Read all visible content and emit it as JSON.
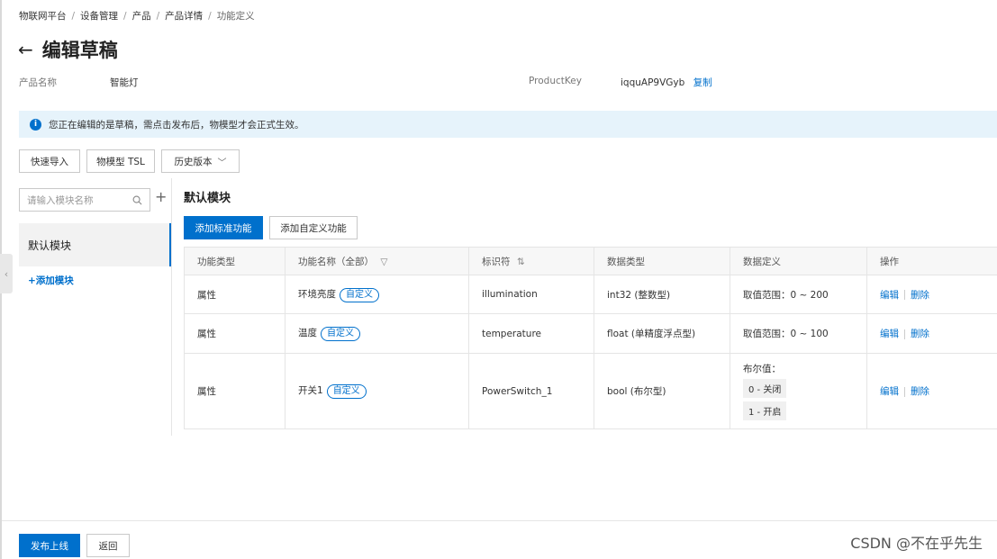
{
  "breadcrumb": [
    "物联网平台",
    "设备管理",
    "产品",
    "产品详情",
    "功能定义"
  ],
  "page": {
    "title": "编辑草稿",
    "back_icon": "arrow-left-icon"
  },
  "product": {
    "name_label": "产品名称",
    "name_value": "智能灯",
    "key_label": "ProductKey",
    "key_value": "iqquAP9VGyb",
    "copy_label": "复制"
  },
  "notice": {
    "icon": "info-icon",
    "text": "您正在编辑的是草稿，需点击发布后，物模型才会正式生效。"
  },
  "toolbar": {
    "quick_import": "快速导入",
    "tsl": "物模型 TSL",
    "history": "历史版本"
  },
  "sidebar": {
    "search_placeholder": "请输入模块名称",
    "active_module": "默认模块",
    "add_module": "+添加模块"
  },
  "main": {
    "section_title": "默认模块",
    "add_standard": "添加标准功能",
    "add_custom": "添加自定义功能",
    "columns": [
      "功能类型",
      "功能名称（全部）",
      "标识符",
      "数据类型",
      "数据定义",
      "操作"
    ],
    "rows": [
      {
        "type": "属性",
        "name": "环境亮度",
        "tag": "自定义",
        "identifier": "illumination",
        "data_type": "int32 (整数型)",
        "definition": "取值范围：0 ~ 200",
        "edit": "编辑",
        "delete": "删除"
      },
      {
        "type": "属性",
        "name": "温度",
        "tag": "自定义",
        "identifier": "temperature",
        "data_type": "float (单精度浮点型)",
        "definition": "取值范围：0 ~ 100",
        "edit": "编辑",
        "delete": "删除"
      },
      {
        "type": "属性",
        "name": "开关1",
        "tag": "自定义",
        "identifier": "PowerSwitch_1",
        "data_type": "bool (布尔型)",
        "definition_title": "布尔值：",
        "bool_options": [
          "0 - 关闭",
          "1 - 开启"
        ],
        "edit": "编辑",
        "delete": "删除"
      }
    ]
  },
  "footer": {
    "publish": "发布上线",
    "back": "返回"
  },
  "watermark": "CSDN @不在乎先生",
  "colors": {
    "primary": "#0070cc",
    "notice_bg": "#e6f3fb"
  }
}
